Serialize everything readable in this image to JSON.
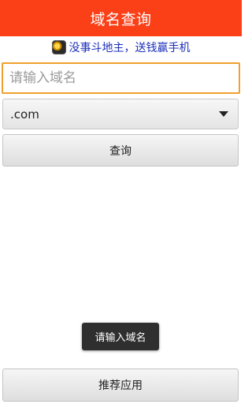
{
  "header": {
    "title": "域名查询"
  },
  "ad": {
    "text": "没事斗地主，送钱赢手机",
    "icon": "game-icon"
  },
  "search": {
    "placeholder": "请输入域名",
    "value": ""
  },
  "tld_select": {
    "selected": ".com"
  },
  "buttons": {
    "query": "查询",
    "recommend": "推荐应用"
  },
  "toast": {
    "message": "请输入域名"
  },
  "colors": {
    "title_bar": "#fb3f17",
    "ad_text": "#1c2fb9",
    "input_border_focus": "#f0a02c"
  }
}
